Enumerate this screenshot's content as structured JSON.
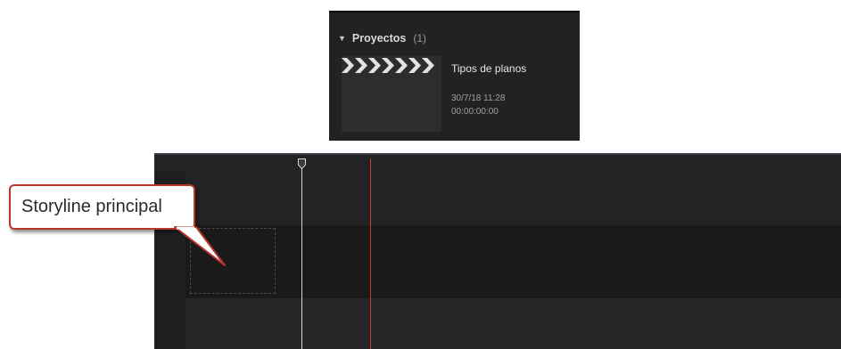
{
  "browser": {
    "section": {
      "disclosure_glyph": "▼",
      "title": "Proyectos",
      "count": "(1)"
    },
    "project": {
      "name": "Tipos de planos",
      "date": "30/7/18 11:28",
      "duration": "00:00:00:00",
      "thumbnail_icon": "clapperboard-icon"
    }
  },
  "timeline": {
    "playhead_icon": "playhead-icon",
    "colors": {
      "skimmer": "#d6362a",
      "playhead": "#d2d2d2",
      "storyline_band": "#1a1a1a"
    }
  },
  "callout": {
    "label": "Storyline principal",
    "border_color": "#b8372d"
  }
}
